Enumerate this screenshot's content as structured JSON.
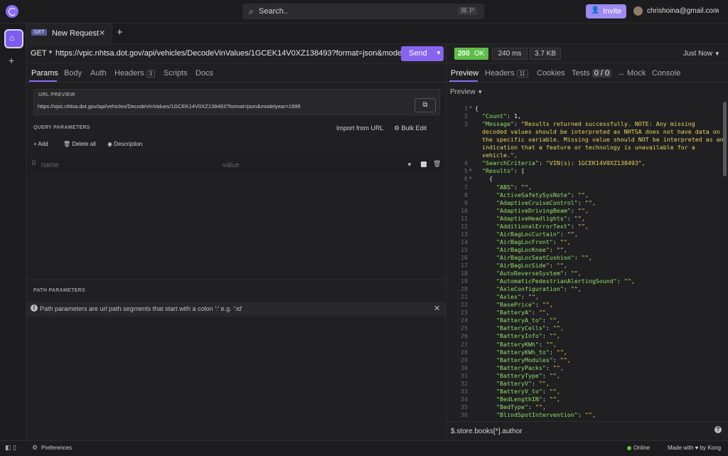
{
  "topbar": {
    "search_label": "Search..",
    "search_shortcut": "⌘ P",
    "invite_label": "Invite",
    "user_email": "chrishoina@gmail.com"
  },
  "tab": {
    "method_badge": "GET",
    "title": "New Request"
  },
  "request": {
    "method": "GET",
    "url": "https://vpic.nhtsa.dot.gov/api/vehicles/DecodeVinValues/1GCEK14V0XZ138493?format=json&modelyear=1999",
    "send_label": "Send",
    "tabs": {
      "params": "Params",
      "body": "Body",
      "auth": "Auth",
      "headers": "Headers",
      "headers_count": "3",
      "scripts": "Scripts",
      "docs": "Docs"
    },
    "url_preview_title": "URL PREVIEW",
    "url_preview_value": "https://vpic.nhtsa.dot.gov/api/vehicles/DecodeVinValues/1GCEK14V0XZ138493?format=json&modelyear=1999",
    "query_params_title": "QUERY PARAMETERS",
    "import_from_url": "Import from URL",
    "bulk_edit": "Bulk Edit",
    "add_label": "Add",
    "delete_all_label": "Delete all",
    "description_label": "Description",
    "name_placeholder": "name",
    "value_placeholder": "value",
    "path_params_title": "PATH PARAMETERS",
    "path_params_info": "Path parameters are url path segments that start with a colon ':' e.g. ':id'"
  },
  "response": {
    "status_code": "200",
    "status_text": "OK",
    "time": "240 ms",
    "size": "3.7 KB",
    "timestamp": "Just Now",
    "tabs": {
      "preview": "Preview",
      "headers": "Headers",
      "headers_count": "11",
      "cookies": "Cookies",
      "tests": "Tests",
      "tests_count": "0 / 0",
      "mock": "→ Mock",
      "console": "Console"
    },
    "preview_mode": "Preview",
    "filter_text": "$.store.books[*].author"
  },
  "code_lines": [
    {
      "n": "1",
      "t": "{"
    },
    {
      "n": "2",
      "t": "  \"Count\": 1,"
    },
    {
      "n": "3",
      "t": "  \"Message\": \"Results returned successfully. NOTE: Any missing"
    },
    {
      "n": "",
      "t": "  decoded values should be interpreted as NHTSA does not have data on"
    },
    {
      "n": "",
      "t": "  the specific variable. Missing value should NOT be interpreted as an"
    },
    {
      "n": "",
      "t": "  indication that a feature or technology is unavailable for a"
    },
    {
      "n": "",
      "t": "  vehicle.\","
    },
    {
      "n": "4",
      "t": "  \"SearchCriteria\": \"VIN(s): 1GCEK14V0XZ138493\","
    },
    {
      "n": "5",
      "t": "  \"Results\": ["
    },
    {
      "n": "6",
      "t": "    {"
    },
    {
      "n": "7",
      "t": "      \"ABS\": \"\","
    },
    {
      "n": "8",
      "t": "      \"ActiveSafetySysNote\": \"\","
    },
    {
      "n": "9",
      "t": "      \"AdaptiveCruiseControl\": \"\","
    },
    {
      "n": "10",
      "t": "      \"AdaptiveDrivingBeam\": \"\","
    },
    {
      "n": "11",
      "t": "      \"AdaptiveHeadlights\": \"\","
    },
    {
      "n": "12",
      "t": "      \"AdditionalErrorText\": \"\","
    },
    {
      "n": "13",
      "t": "      \"AirBagLocCurtain\": \"\","
    },
    {
      "n": "14",
      "t": "      \"AirBagLocFront\": \"\","
    },
    {
      "n": "15",
      "t": "      \"AirBagLocKnee\": \"\","
    },
    {
      "n": "16",
      "t": "      \"AirBagLocSeatCushion\": \"\","
    },
    {
      "n": "17",
      "t": "      \"AirBagLocSide\": \"\","
    },
    {
      "n": "18",
      "t": "      \"AutoReverseSystem\": \"\","
    },
    {
      "n": "19",
      "t": "      \"AutomaticPedestrianAlertingSound\": \"\","
    },
    {
      "n": "20",
      "t": "      \"AxleConfiguration\": \"\","
    },
    {
      "n": "21",
      "t": "      \"Axles\": \"\","
    },
    {
      "n": "22",
      "t": "      \"BasePrice\": \"\","
    },
    {
      "n": "23",
      "t": "      \"BatteryA\": \"\","
    },
    {
      "n": "24",
      "t": "      \"BatteryA_to\": \"\","
    },
    {
      "n": "25",
      "t": "      \"BatteryCells\": \"\","
    },
    {
      "n": "26",
      "t": "      \"BatteryInfo\": \"\","
    },
    {
      "n": "27",
      "t": "      \"BatteryKWh\": \"\","
    },
    {
      "n": "28",
      "t": "      \"BatteryKWh_to\": \"\","
    },
    {
      "n": "29",
      "t": "      \"BatteryModules\": \"\","
    },
    {
      "n": "30",
      "t": "      \"BatteryPacks\": \"\","
    },
    {
      "n": "31",
      "t": "      \"BatteryType\": \"\","
    },
    {
      "n": "32",
      "t": "      \"BatteryV\": \"\","
    },
    {
      "n": "33",
      "t": "      \"BatteryV_to\": \"\","
    },
    {
      "n": "34",
      "t": "      \"BedLengthIN\": \"\","
    },
    {
      "n": "35",
      "t": "      \"BedType\": \"\","
    },
    {
      "n": "36",
      "t": "      \"BlindSpotIntervention\": \"\","
    }
  ],
  "statusbar": {
    "preferences": "Preferences",
    "online": "Online",
    "made_with": "Made with ♥ by Kong"
  },
  "colors": {
    "accent": "#8a6cf5",
    "status_ok": "#5fbf49",
    "json_key": "#92e066",
    "json_string": "#e8d25c"
  },
  "icons": [
    "logo-icon",
    "search-icon",
    "invite-user-icon",
    "home-icon",
    "plus-icon",
    "close-icon",
    "chevron-down-icon",
    "copy-icon",
    "bulk-edit-icon",
    "trash-icon",
    "info-icon",
    "gear-icon",
    "sidebar-toggle-icon",
    "help-icon"
  ]
}
